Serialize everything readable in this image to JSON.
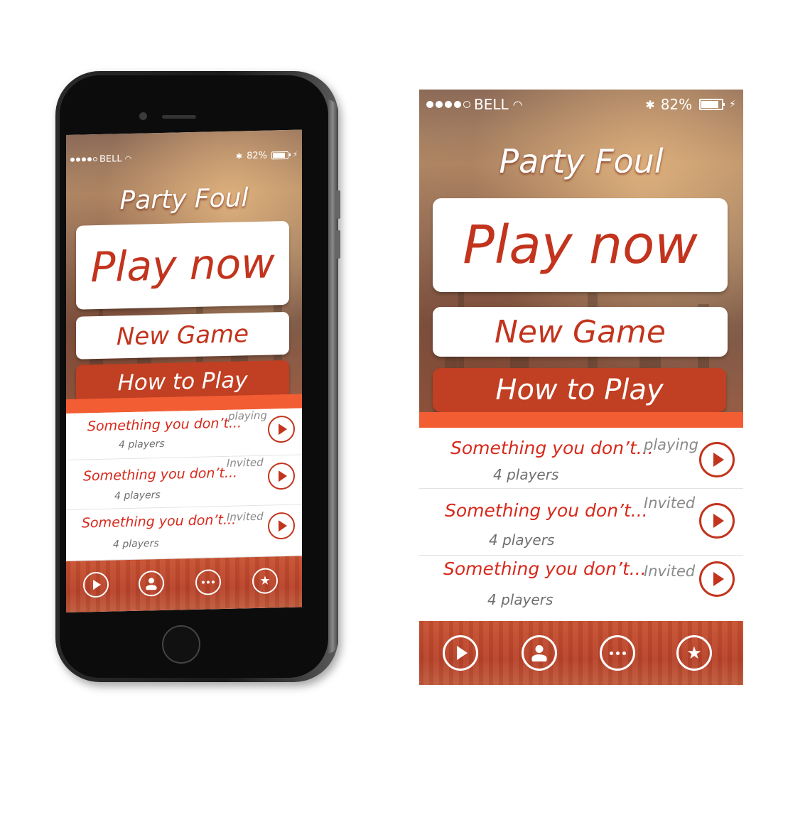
{
  "status_bar": {
    "carrier": "BELL",
    "battery_text": "82%",
    "battery_level": 0.82,
    "icons": [
      "signal-dots-icon",
      "wifi-icon",
      "bluetooth-icon",
      "battery-icon",
      "charging-bolt-icon"
    ]
  },
  "app": {
    "title": "Party Foul",
    "play_now_label": "Play now",
    "new_game_label": "New Game",
    "how_to_play_label": "How to Play"
  },
  "games": [
    {
      "name": "Something you don’t...",
      "players": "4 players",
      "status": "playing"
    },
    {
      "name": "Something you don’t...",
      "players": "4 players",
      "status": "Invited"
    },
    {
      "name": "Something you don’t...",
      "players": "4 players",
      "status": "Invited"
    }
  ],
  "tabbar": {
    "items": [
      {
        "icon": "play-icon"
      },
      {
        "icon": "profile-icon"
      },
      {
        "icon": "more-icon"
      },
      {
        "icon": "star-icon"
      }
    ]
  },
  "colors": {
    "brand_red": "#c2341d",
    "accent_orange": "#f25d33",
    "button_red": "#c13f22",
    "text_red": "#d7291b"
  }
}
